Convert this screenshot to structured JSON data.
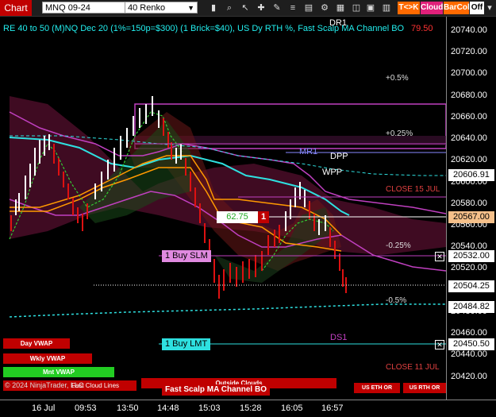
{
  "toolbar": {
    "chart_button": "Chart",
    "instrument": "MNQ 09-24",
    "bar_type": "40 Renko",
    "badge_tk": "T<>K",
    "badge_cloud": "Cloud",
    "badge_barcol": "BarCol",
    "badge_off": "Off"
  },
  "title": "RE 40 to 50 (M)NQ Dec 20 (1%=150p=$300) (1 Brick=$40), US Dy RTH %, Fast Scalp MA Channel BO",
  "title_right_value": "79.50",
  "levels": {
    "dr1": "DR1",
    "mr1": "MR1",
    "dpp": "DPP",
    "wpp": "WPP",
    "ds1": "DS1",
    "pct_05": "+0.5%",
    "pct_025": "+0.25%",
    "neg_025": "-0.25%",
    "neg_05": "-0.5%",
    "close_15jul": "CLOSE 15 JUL",
    "close_11jul": "CLOSE 11 JUL"
  },
  "orders": {
    "buy_slm": "1 Buy SLM",
    "buy_lmt": "1 Buy LMT",
    "pnl_value": "62.75",
    "pnl_qty": "1"
  },
  "bottom_labels": {
    "day_vwap": "Day VWAP",
    "wkly_vwap": "Wkly VWAP",
    "mnt_vwap": "Mnt VWAP",
    "copyright": "© 2024 NinjaTrader, LLC",
    "fast_cloud": "Fast Cloud Lines",
    "outside_clouds": "Outside Clouds",
    "fast_scalp": "Fast Scalp MA Channel BO",
    "us_eth_or": "US ETH OR",
    "us_rth_or": "US RTH OR"
  },
  "price_axis": {
    "ticks": [
      "20740.00",
      "20720.00",
      "20700.00",
      "20680.00",
      "20660.00",
      "20640.00",
      "20620.00",
      "20600.00",
      "20580.00",
      "20560.00",
      "20540.00",
      "20520.00",
      "20500.00",
      "20480.00",
      "20460.00",
      "20440.00",
      "20420.00"
    ],
    "tags": [
      {
        "value": "20606.91",
        "color": "#ffffff"
      },
      {
        "value": "20567.00",
        "color": "#f5c08a"
      },
      {
        "value": "20532.00",
        "color": "#ffffff"
      },
      {
        "value": "20504.25",
        "color": "#ffffff"
      },
      {
        "value": "20484.82",
        "color": "#ffffff"
      },
      {
        "value": "20450.50",
        "color": "#ffffff"
      }
    ]
  },
  "time_axis": {
    "ticks": [
      "16 Jul",
      "09:53",
      "13:50",
      "14:48",
      "15:03",
      "15:28",
      "16:05",
      "16:57"
    ]
  },
  "colors": {
    "accent_red": "#c00000",
    "cyan": "#2ee0e0",
    "magenta": "#c040c0",
    "orange": "#ff9900",
    "green_candle": "#22aa22",
    "red_candle": "#dd1111"
  }
}
